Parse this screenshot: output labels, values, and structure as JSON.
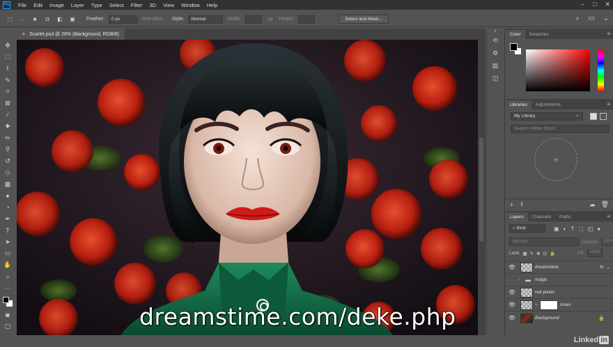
{
  "menubar": {
    "logo": "Ps",
    "items": [
      "File",
      "Edit",
      "Image",
      "Layer",
      "Type",
      "Select",
      "Filter",
      "3D",
      "View",
      "Window",
      "Help"
    ]
  },
  "options": {
    "feather_label": "Feather:",
    "feather_value": "0 px",
    "antialias_label": "Anti-alias",
    "style_label": "Style:",
    "style_value": "Normal",
    "width_label": "Width:",
    "height_label": "Height:",
    "select_mask_label": "Select and Mask..."
  },
  "document": {
    "tab_title": "Scarlet.psd @ 28% (Background, RGB/8)",
    "close_glyph": "×"
  },
  "watermark": "dreamstime.com/deke.php",
  "color_panel": {
    "tabs": [
      "Color",
      "Swatches"
    ],
    "fg_color": "#000000",
    "bg_color": "#ffffff"
  },
  "libraries": {
    "tabs": [
      "Libraries",
      "Adjustments"
    ],
    "library_name": "My Library",
    "search_placeholder": "Search Adobe Stock",
    "add_glyph": "+"
  },
  "layers_panel": {
    "tabs": [
      "Layers",
      "Channels",
      "Paths"
    ],
    "kind_label": "Kind",
    "blend_mode": "Normal",
    "opacity_label": "Opacity:",
    "opacity_value": "100%",
    "lock_label": "Lock:",
    "fill_label": "Fill:",
    "fill_value": "100%",
    "layers": [
      {
        "name": "dreamstime",
        "visible": true,
        "fx": "fx"
      },
      {
        "name": "magic",
        "visible": false,
        "type": "group"
      },
      {
        "name": "red pixels",
        "visible": true
      },
      {
        "name": "irises",
        "visible": true
      },
      {
        "name": "Background",
        "visible": true,
        "locked": true
      }
    ]
  },
  "branding": {
    "linkedin_a": "Linked",
    "linkedin_b": "in"
  }
}
